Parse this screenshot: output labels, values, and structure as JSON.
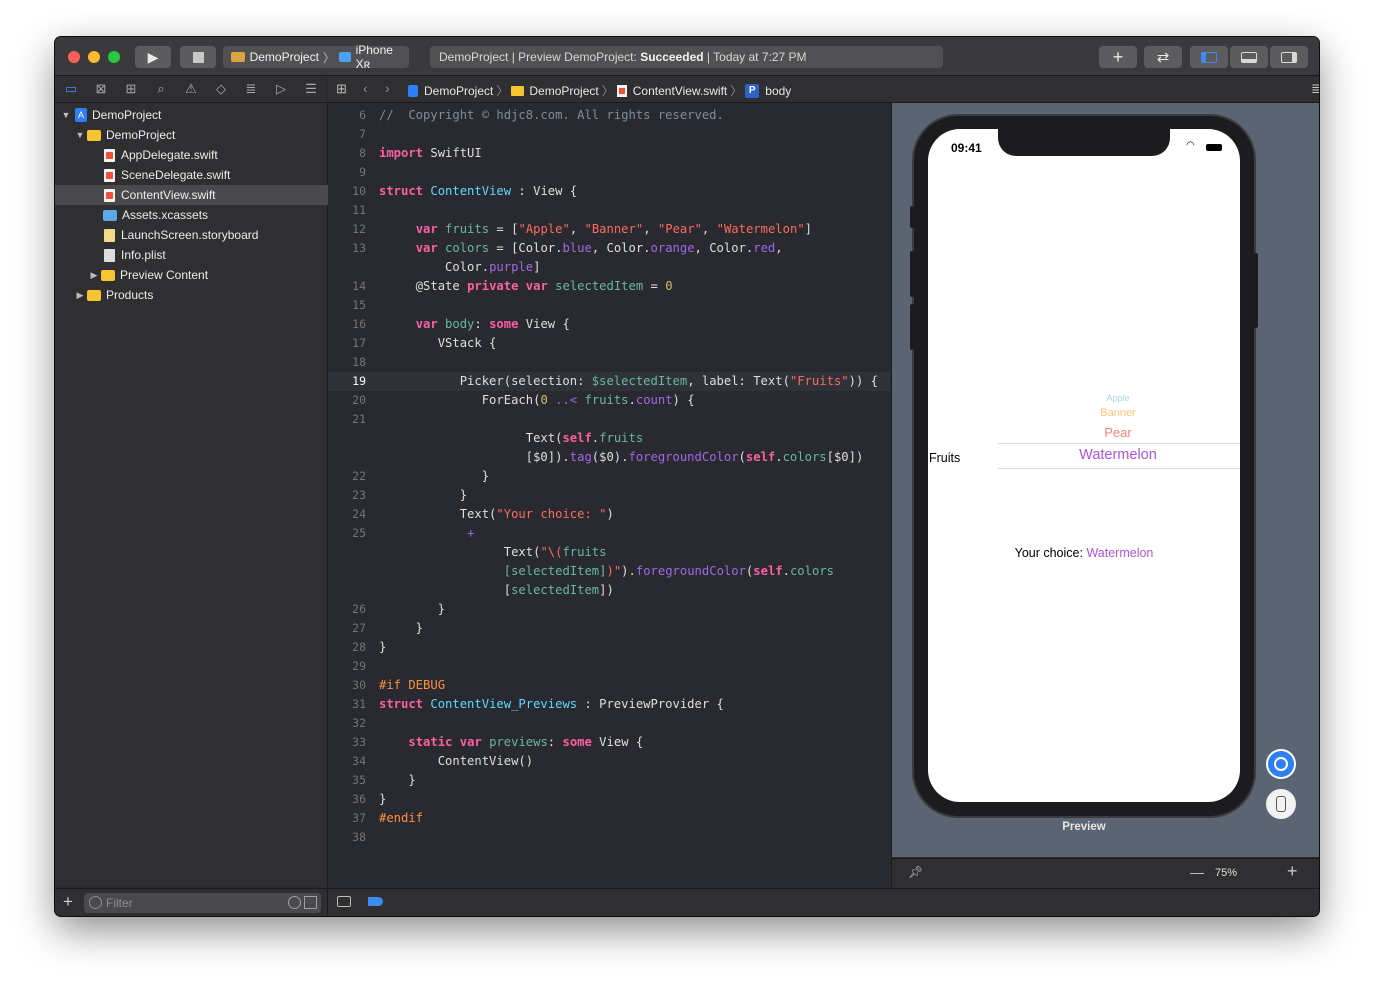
{
  "toolbar": {
    "scheme": "DemoProject",
    "device": "iPhone Xʀ",
    "status_prefix": "DemoProject | Preview DemoProject:",
    "status_result": "Succeeded",
    "status_time": "| Today at 7:27 PM",
    "add_label": "+",
    "swap_label": "⇄"
  },
  "navigator": {
    "items": [
      {
        "label": "DemoProject"
      },
      {
        "label": "DemoProject"
      },
      {
        "label": "AppDelegate.swift"
      },
      {
        "label": "SceneDelegate.swift"
      },
      {
        "label": "ContentView.swift"
      },
      {
        "label": "Assets.xcassets"
      },
      {
        "label": "LaunchScreen.storyboard"
      },
      {
        "label": "Info.plist"
      },
      {
        "label": "Preview Content"
      },
      {
        "label": "Products"
      }
    ],
    "filter_placeholder": "Filter"
  },
  "jumpbar": {
    "crumbs": [
      "DemoProject",
      "DemoProject",
      "ContentView.swift",
      "body"
    ],
    "symbol_badge": "P"
  },
  "editor": {
    "lines": [
      {
        "n": "6",
        "tokens": [
          [
            "cmt",
            "//  Copyright © hdjc8.com. All rights reserved."
          ]
        ]
      },
      {
        "n": "7",
        "tokens": []
      },
      {
        "n": "8",
        "tokens": [
          [
            "kw",
            "import"
          ],
          [
            "",
            " SwiftUI"
          ]
        ]
      },
      {
        "n": "9",
        "tokens": []
      },
      {
        "n": "10",
        "tokens": [
          [
            "kw",
            "struct"
          ],
          [
            "",
            " "
          ],
          [
            "typ",
            "ContentView"
          ],
          [
            "",
            " : View {"
          ]
        ]
      },
      {
        "n": "11",
        "tokens": []
      },
      {
        "n": "12",
        "tokens": [
          [
            "",
            "     "
          ],
          [
            "kw",
            "var"
          ],
          [
            "",
            " "
          ],
          [
            "prop",
            "fruits"
          ],
          [
            "",
            " = ["
          ],
          [
            "str",
            "\"Apple\""
          ],
          [
            "",
            ", "
          ],
          [
            "str",
            "\"Banner\""
          ],
          [
            "",
            ", "
          ],
          [
            "str",
            "\"Pear\""
          ],
          [
            "",
            ", "
          ],
          [
            "str",
            "\"Watermelon\""
          ],
          [
            "",
            "]"
          ]
        ]
      },
      {
        "n": "13",
        "tokens": [
          [
            "",
            "     "
          ],
          [
            "kw",
            "var"
          ],
          [
            "",
            " "
          ],
          [
            "prop",
            "colors"
          ],
          [
            "",
            " = [Color."
          ],
          [
            "mem",
            "blue"
          ],
          [
            "",
            ", Color."
          ],
          [
            "mem",
            "orange"
          ],
          [
            "",
            ", Color."
          ],
          [
            "mem",
            "red"
          ],
          [
            "",
            ","
          ]
        ]
      },
      {
        "n": "",
        "tokens": [
          [
            "",
            "         Color."
          ],
          [
            "mem",
            "purple"
          ],
          [
            "",
            "]"
          ]
        ]
      },
      {
        "n": "14",
        "tokens": [
          [
            "",
            "     @State "
          ],
          [
            "kw",
            "private"
          ],
          [
            "",
            " "
          ],
          [
            "kw",
            "var"
          ],
          [
            "",
            " "
          ],
          [
            "prop",
            "selectedItem"
          ],
          [
            "",
            " = "
          ],
          [
            "num",
            "0"
          ]
        ]
      },
      {
        "n": "15",
        "tokens": []
      },
      {
        "n": "16",
        "tokens": [
          [
            "",
            "     "
          ],
          [
            "kw",
            "var"
          ],
          [
            "",
            " "
          ],
          [
            "prop",
            "body"
          ],
          [
            "",
            ": "
          ],
          [
            "kw",
            "some"
          ],
          [
            "",
            " View {"
          ]
        ]
      },
      {
        "n": "17",
        "tokens": [
          [
            "",
            "        VStack {"
          ]
        ]
      },
      {
        "n": "18",
        "tokens": []
      },
      {
        "n": "19",
        "tokens": [
          [
            "",
            "           Picker(selection: "
          ],
          [
            "prop",
            "$selectedItem"
          ],
          [
            "",
            ", label: Text("
          ],
          [
            "str",
            "\"Fruits\""
          ],
          [
            "",
            ")) {"
          ]
        ],
        "current": true
      },
      {
        "n": "20",
        "tokens": [
          [
            "",
            "              ForEach("
          ],
          [
            "num",
            "0"
          ],
          [
            "",
            " "
          ],
          [
            "mem",
            "..<"
          ],
          [
            "",
            " "
          ],
          [
            "prop",
            "fruits"
          ],
          [
            "",
            "."
          ],
          [
            "mem",
            "count"
          ],
          [
            "",
            ") {"
          ]
        ]
      },
      {
        "n": "21",
        "tokens": []
      },
      {
        "n": "",
        "tokens": [
          [
            "",
            "                    Text("
          ],
          [
            "kw",
            "self"
          ],
          [
            "",
            "."
          ],
          [
            "prop",
            "fruits"
          ]
        ]
      },
      {
        "n": "",
        "tokens": [
          [
            "",
            "                    [$0])."
          ],
          [
            "mem",
            "tag"
          ],
          [
            "",
            "($0)."
          ],
          [
            "mem",
            "foregroundColor"
          ],
          [
            "",
            "("
          ],
          [
            "kw",
            "self"
          ],
          [
            "",
            "."
          ],
          [
            "prop",
            "colors"
          ],
          [
            "",
            "[$0])"
          ]
        ]
      },
      {
        "n": "22",
        "tokens": [
          [
            "",
            "              }"
          ]
        ]
      },
      {
        "n": "23",
        "tokens": [
          [
            "",
            "           }"
          ]
        ]
      },
      {
        "n": "24",
        "tokens": [
          [
            "",
            "           Text("
          ],
          [
            "str",
            "\"Your choice: \""
          ],
          [
            "",
            ")"
          ]
        ]
      },
      {
        "n": "25",
        "tokens": [
          [
            "",
            "            "
          ],
          [
            "mem",
            "+"
          ]
        ]
      },
      {
        "n": "",
        "tokens": [
          [
            "",
            "                 Text("
          ],
          [
            "str",
            "\"\\("
          ],
          [
            "prop",
            "fruits"
          ]
        ]
      },
      {
        "n": "",
        "tokens": [
          [
            "",
            "                 "
          ],
          [
            "prop",
            "[selectedItem]"
          ],
          [
            "str",
            ")\""
          ],
          [
            "",
            ")."
          ],
          [
            "mem",
            "foregroundColor"
          ],
          [
            "",
            "("
          ],
          [
            "kw",
            "self"
          ],
          [
            "",
            "."
          ],
          [
            "prop",
            "colors"
          ]
        ]
      },
      {
        "n": "",
        "tokens": [
          [
            "",
            "                 ["
          ],
          [
            "prop",
            "selectedItem"
          ],
          [
            "",
            "])"
          ]
        ]
      },
      {
        "n": "26",
        "tokens": [
          [
            "",
            "        }"
          ]
        ]
      },
      {
        "n": "27",
        "tokens": [
          [
            "",
            "     }"
          ]
        ]
      },
      {
        "n": "28",
        "tokens": [
          [
            "",
            "}"
          ]
        ]
      },
      {
        "n": "29",
        "tokens": []
      },
      {
        "n": "30",
        "tokens": [
          [
            "pre",
            "#if DEBUG"
          ]
        ]
      },
      {
        "n": "31",
        "tokens": [
          [
            "kw",
            "struct"
          ],
          [
            "",
            " "
          ],
          [
            "typ",
            "ContentView_Previews"
          ],
          [
            "",
            " : PreviewProvider {"
          ]
        ]
      },
      {
        "n": "32",
        "tokens": []
      },
      {
        "n": "33",
        "tokens": [
          [
            "",
            "    "
          ],
          [
            "kw",
            "static"
          ],
          [
            "",
            " "
          ],
          [
            "kw",
            "var"
          ],
          [
            "",
            " "
          ],
          [
            "prop",
            "previews"
          ],
          [
            "",
            ": "
          ],
          [
            "kw",
            "some"
          ],
          [
            "",
            " View {"
          ]
        ]
      },
      {
        "n": "34",
        "tokens": [
          [
            "",
            "        ContentView()"
          ]
        ]
      },
      {
        "n": "35",
        "tokens": [
          [
            "",
            "    }"
          ]
        ]
      },
      {
        "n": "36",
        "tokens": [
          [
            "",
            "}"
          ]
        ]
      },
      {
        "n": "37",
        "tokens": [
          [
            "pre",
            "#endif"
          ]
        ]
      },
      {
        "n": "38",
        "tokens": []
      }
    ]
  },
  "preview": {
    "time": "09:41",
    "picker_label": "Fruits",
    "picker_items": [
      {
        "label": "Apple",
        "color": "#0a7aff"
      },
      {
        "label": "Banner",
        "color": "#ff9500"
      },
      {
        "label": "Pear",
        "color": "#ff3b30"
      },
      {
        "label": "Watermelon",
        "color": "#af52de"
      }
    ],
    "choice_prefix": "Your choice:",
    "choice_value": "Watermelon",
    "caption": "Preview",
    "zoom": "75%"
  },
  "colors": {
    "accent": "#3d8cf3",
    "selected_purple": "#af52de"
  }
}
